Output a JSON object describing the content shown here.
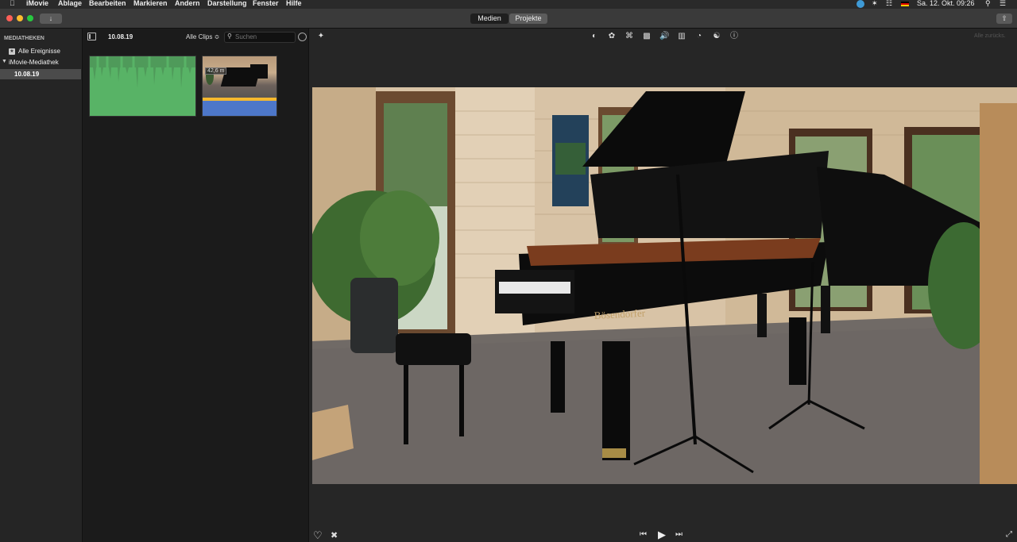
{
  "menubar": {
    "app_name": "iMovie",
    "items": [
      "Ablage",
      "Bearbeiten",
      "Markieren",
      "Ändern",
      "Darstellung",
      "Fenster",
      "Hilfe"
    ],
    "clock": "Sa. 12. Okt.  09:26"
  },
  "toolbar": {
    "tabs": [
      "Medien",
      "Projekte"
    ],
    "active_tab": "Medien"
  },
  "sidebar": {
    "heading": "MEDIATHEKEN",
    "items": [
      {
        "label": "Alle Ereignisse"
      },
      {
        "label": "iMovie-Mediathek"
      },
      {
        "label": "10.08.19"
      }
    ]
  },
  "browser": {
    "event_title": "10.08.19",
    "filter": "Alle Clips ≎",
    "search_placeholder": "Suchen",
    "clip2_duration": "42,6 m"
  },
  "viewer": {
    "reset_label": "Alle zurücks.",
    "brand_text": "Bösendorfer"
  },
  "colors": {
    "accent": "#3a82f7",
    "clip_green": "#58b366",
    "clip_yellow": "#f5b82e",
    "clip_blue": "#4d77c9"
  }
}
